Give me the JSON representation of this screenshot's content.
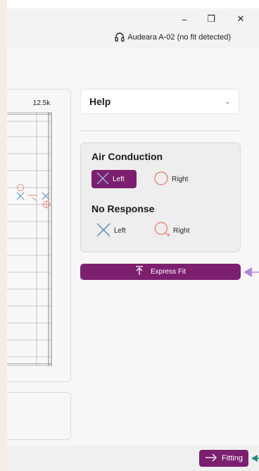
{
  "window": {
    "minimize_glyph": "–",
    "maximize_glyph": "❐",
    "close_glyph": "✕"
  },
  "header": {
    "device_label": "Audeara A-02 (no fit detected)",
    "device_icon": "headphones-icon"
  },
  "audiogram": {
    "frequency_label": "12.5k"
  },
  "help": {
    "title": "Help",
    "chevron": "⌄"
  },
  "legend": {
    "air_conduction_heading": "Air Conduction",
    "no_response_heading": "No Response",
    "left_label": "Left",
    "right_label": "Right",
    "left_color": "#5b8fb9",
    "right_color": "#e88a7c",
    "selected_color": "#7c1f6f"
  },
  "actions": {
    "express_fit_label": "Express Fit",
    "fitting_label": "Fitting",
    "accent_color": "#7c1f6f"
  },
  "pointers": {
    "express_fit_pointer_color": "#b48ad6",
    "fitting_pointer_color": "#1e8a78"
  }
}
